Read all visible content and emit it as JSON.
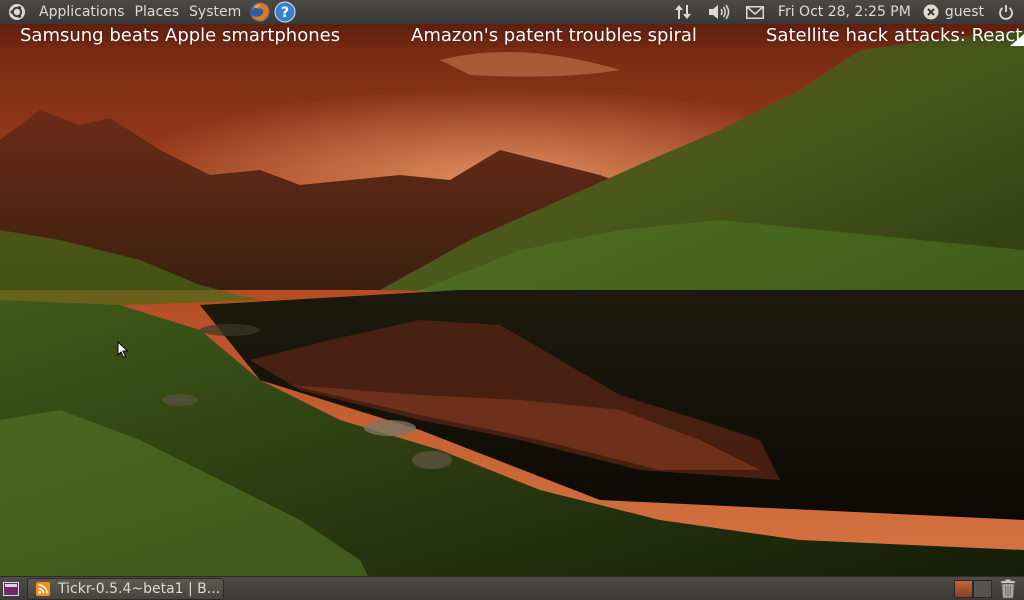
{
  "top_panel": {
    "menus": [
      "Applications",
      "Places",
      "System"
    ],
    "launchers": {
      "browser": "firefox-icon",
      "help": "help-icon"
    },
    "tray": {
      "network": "network-arrows-icon",
      "volume": "speaker-icon",
      "mail": "envelope-icon",
      "clock": "Fri Oct 28,  2:25 PM",
      "user": "guest",
      "session": "power-icon"
    }
  },
  "ticker": {
    "items": [
      "Samsung beats Apple smartphones",
      "Amazon's patent troubles spiral",
      "Satellite hack attacks: React"
    ]
  },
  "bottom_panel": {
    "tasks": [
      {
        "icon": "rss-feed-icon",
        "label": "Tickr-0.5.4~beta1 | B..."
      }
    ],
    "workspaces": {
      "count": 2,
      "active_index": 0
    },
    "trash": "trash-icon"
  },
  "colors": {
    "panel": "#3c3b37",
    "panel_text": "#dfdbd2",
    "ticker_text": "#ffffff",
    "sky": "#c2552a",
    "ubuntu_orange": "#dd4814"
  }
}
